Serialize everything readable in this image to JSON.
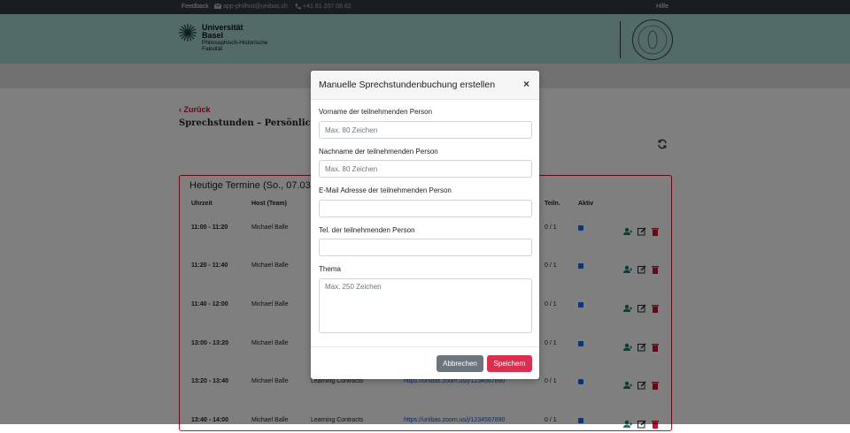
{
  "topbar": {
    "feedback": "Feedback",
    "email": "app-philhist@unibas.ch",
    "phone": "+41 61 207 08 62",
    "help": "Hilfe"
  },
  "header": {
    "logo_line1": "Universität",
    "logo_line2": "Basel",
    "logo_line3": "Philosophisch-Historische",
    "logo_line4": "Fakultät"
  },
  "page": {
    "back_label": "Zurück",
    "title": "Sprechstunden – Persönliche Ta"
  },
  "card": {
    "title": "Heutige Termine (So., 07.03.2",
    "headers": {
      "time": "Uhrzeit",
      "host": "Host (Team)",
      "participants": "Teiln.",
      "active": "Aktiv"
    },
    "rows": [
      {
        "time": "11:00 - 11:20",
        "host": "Michael Balle",
        "topic": "",
        "link": "",
        "participants": "0 / 1",
        "active": true
      },
      {
        "time": "11:20 - 11:40",
        "host": "Michael Balle",
        "topic": "",
        "link": "",
        "participants": "0 / 1",
        "active": true
      },
      {
        "time": "11:40 - 12:00",
        "host": "Michael Balle",
        "topic": "",
        "link": "",
        "participants": "0 / 1",
        "active": true
      },
      {
        "time": "13:00 - 13:20",
        "host": "Michael Balle",
        "topic": "",
        "link": "",
        "participants": "0 / 1",
        "active": true
      },
      {
        "time": "13:20 - 13:40",
        "host": "Michael Balle",
        "topic": "Learning Contracts",
        "link": "https://unibas.zoom.us/j/1234567890",
        "participants": "0 / 1",
        "active": true
      },
      {
        "time": "13:40 - 14:00",
        "host": "Michael Balle",
        "topic": "Learning Contracts",
        "link": "https://unibas.zoom.us/j/1234567890",
        "participants": "0 / 1",
        "active": true
      }
    ]
  },
  "modal": {
    "title": "Manuelle Sprechstundenbuchung erstellen",
    "close": "×",
    "firstname_label": "Vorname der teilnehmenden Person",
    "firstname_placeholder": "Max. 80 Zeichen",
    "lastname_label": "Nachname der teilnehmenden Person",
    "lastname_placeholder": "Max. 80 Zeichen",
    "email_label": "E-Mail Adresse der teilnehmenden Person",
    "phone_label": "Tel. der teilnehmenden Person",
    "topic_label": "Thema",
    "topic_placeholder": "Max. 250 Zeichen",
    "cancel": "Abbrechen",
    "save": "Speichern"
  },
  "colors": {
    "accent_red": "#c8102e",
    "header_mint": "#a5d7d0",
    "icon_teal": "#1f7a6d"
  }
}
